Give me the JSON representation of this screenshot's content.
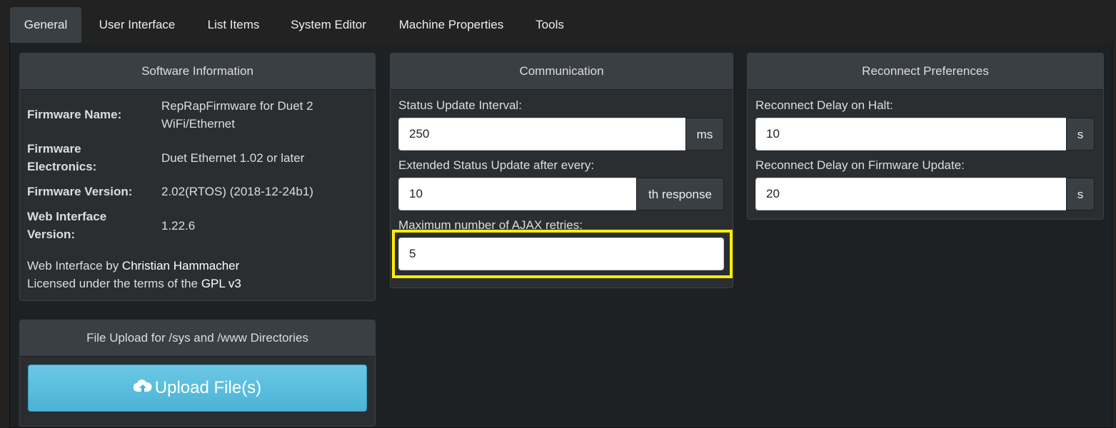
{
  "tabs": {
    "general": "General",
    "user_interface": "User Interface",
    "list_items": "List Items",
    "system_editor": "System Editor",
    "machine_properties": "Machine Properties",
    "tools": "Tools"
  },
  "software_info": {
    "title": "Software Information",
    "firmware_name_key": "Firmware Name:",
    "firmware_name_val_1": "RepRapFirmware for Duet 2",
    "firmware_name_val_2": "WiFi/Ethernet",
    "firmware_electronics_key_1": "Firmware",
    "firmware_electronics_key_2": "Electronics:",
    "firmware_electronics_val": "Duet Ethernet 1.02 or later",
    "firmware_version_key": "Firmware Version:",
    "firmware_version_val": "2.02(RTOS) (2018-12-24b1)",
    "web_interface_version_key_1": "Web Interface",
    "web_interface_version_key_2": "Version:",
    "web_interface_version_val": "1.22.6",
    "credit_prefix": "Web Interface by ",
    "credit_author": "Christian Hammacher",
    "license_prefix": "Licensed under the terms of the ",
    "license_name": "GPL v3"
  },
  "communication": {
    "title": "Communication",
    "status_interval_label": "Status Update Interval:",
    "status_interval_value": "250",
    "status_interval_unit": "ms",
    "extended_label": "Extended Status Update after every:",
    "extended_value": "10",
    "extended_unit": "th response",
    "ajax_label": "Maximum number of AJAX retries:",
    "ajax_value": "5"
  },
  "reconnect": {
    "title": "Reconnect Preferences",
    "halt_label": "Reconnect Delay on Halt:",
    "halt_value": "10",
    "halt_unit": "s",
    "fw_label": "Reconnect Delay on Firmware Update:",
    "fw_value": "20",
    "fw_unit": "s"
  },
  "file_upload": {
    "title": "File Upload for /sys and /www Directories",
    "button_label": "Upload File(s)",
    "icon": "cloud-upload-icon"
  },
  "colors": {
    "highlight": "#ffee00",
    "upload_button": "#5bc0de"
  }
}
